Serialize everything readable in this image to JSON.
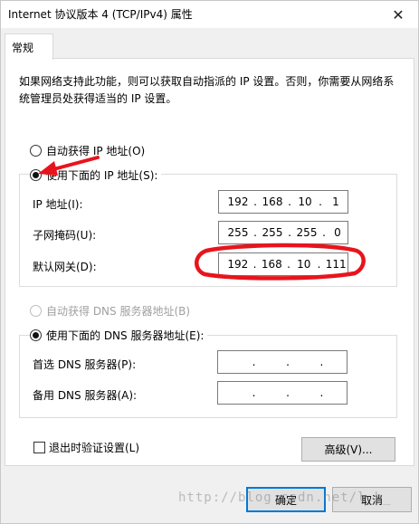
{
  "window": {
    "title": "Internet 协议版本 4 (TCP/IPv4) 属性",
    "close_glyph": "✕"
  },
  "tabs": [
    {
      "label": "常规"
    }
  ],
  "general": {
    "description": "如果网络支持此功能，则可以获取自动指派的 IP 设置。否则，你需要从网络系统管理员处获得适当的 IP 设置。",
    "ip_auto_label": "自动获得 IP 地址(O)",
    "ip_manual_label": "使用下面的 IP 地址(S):",
    "ip_fields": [
      {
        "label": "IP 地址(I):",
        "segments": [
          "192",
          "168",
          "10",
          "1"
        ]
      },
      {
        "label": "子网掩码(U):",
        "segments": [
          "255",
          "255",
          "255",
          "0"
        ]
      },
      {
        "label": "默认网关(D):",
        "segments": [
          "192",
          "168",
          "10",
          "111"
        ]
      }
    ],
    "dns_auto_label": "自动获得 DNS 服务器地址(B)",
    "dns_manual_label": "使用下面的 DNS 服务器地址(E):",
    "dns_fields": [
      {
        "label": "首选 DNS 服务器(P):",
        "segments": [
          "",
          "",
          "",
          ""
        ]
      },
      {
        "label": "备用 DNS 服务器(A):",
        "segments": [
          "",
          "",
          "",
          ""
        ]
      }
    ],
    "validate_label": "退出时验证设置(L)",
    "advanced_label": "高级(V)..."
  },
  "footer": {
    "ok_label": "确定",
    "cancel_label": "取消"
  },
  "watermark": "http://blog.csdn.net/l_b_",
  "annotation": {
    "color": "#e8141c",
    "icons": [
      "arrow-annotation",
      "circle-annotation"
    ]
  }
}
